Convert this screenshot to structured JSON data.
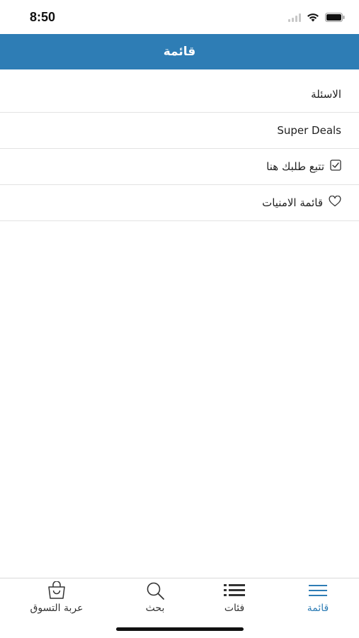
{
  "status_bar": {
    "time": "8:50"
  },
  "header": {
    "title": "قائمة"
  },
  "menu": {
    "items": [
      {
        "label": "الاسئلة",
        "icon": ""
      },
      {
        "label": "Super Deals",
        "icon": ""
      },
      {
        "label": "تتبع طلبك هنا",
        "icon": "checkbox-icon"
      },
      {
        "label": "قائمة الامنيات",
        "icon": "heart-icon"
      }
    ]
  },
  "tab_bar": {
    "tabs": [
      {
        "label": "عربة التسوق",
        "icon": "shopping-bag-icon",
        "active": false
      },
      {
        "label": "بحث",
        "icon": "search-icon",
        "active": false
      },
      {
        "label": "فئات",
        "icon": "list-icon",
        "active": false
      },
      {
        "label": "قائمة",
        "icon": "menu-icon",
        "active": true
      }
    ]
  },
  "colors": {
    "accent": "#2e7db5",
    "divider": "#e3e3e3"
  }
}
